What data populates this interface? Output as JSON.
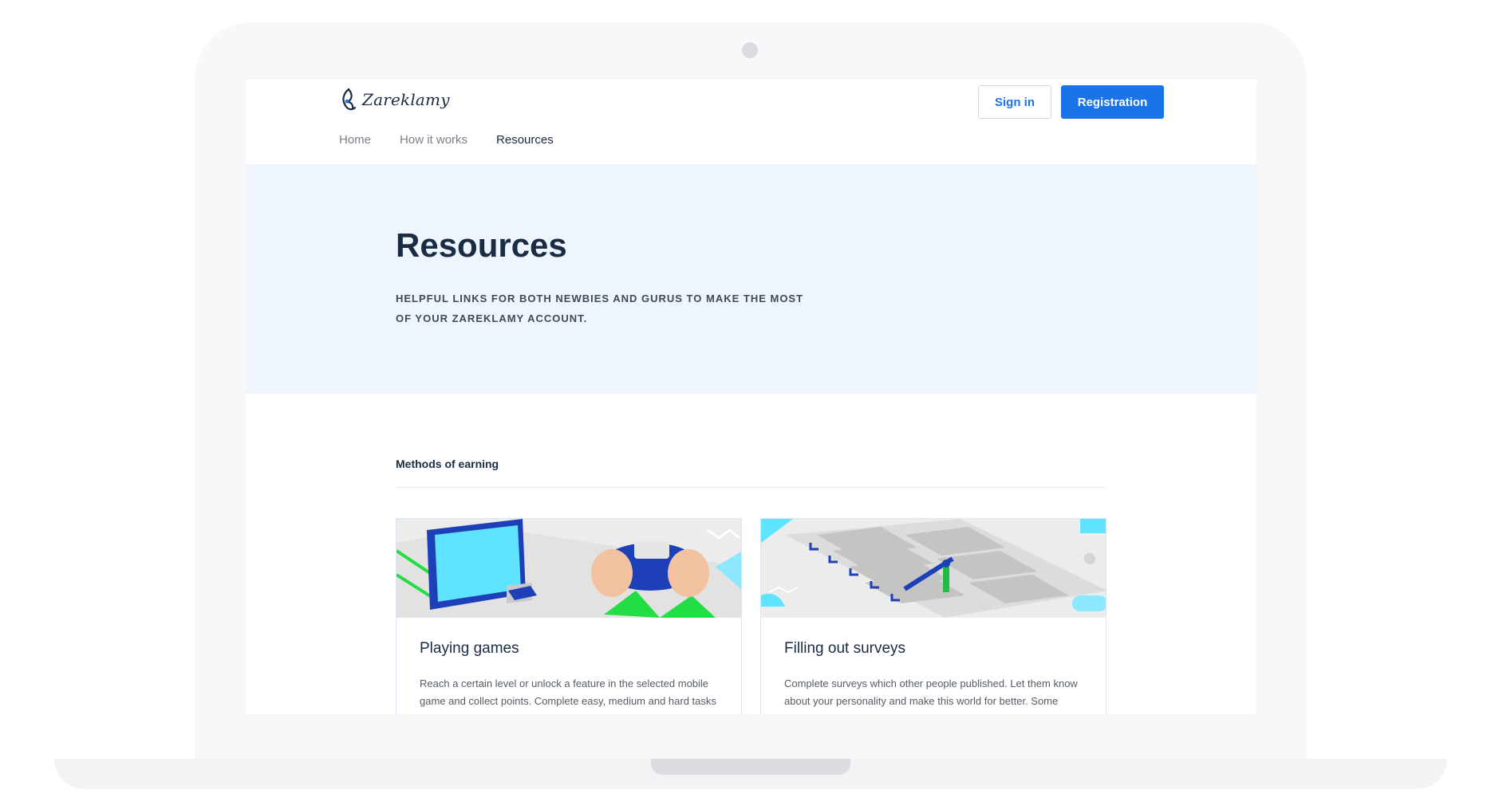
{
  "brand": {
    "name": "Zareklamy"
  },
  "header": {
    "signin_label": "Sign in",
    "register_label": "Registration"
  },
  "nav": {
    "items": [
      {
        "label": "Home"
      },
      {
        "label": "How it works"
      },
      {
        "label": "Resources"
      }
    ],
    "active": "Resources"
  },
  "hero": {
    "title": "Resources",
    "subtitle": "Helpful links for both newbies and gurus to make the most of your Zareklamy account."
  },
  "section": {
    "title": "Methods of earning",
    "cards": [
      {
        "title": "Playing games",
        "text": "Reach a certain level or unlock a feature in the selected mobile game and collect points. Complete easy, medium and hard tasks in games you like. The longer it takes, more to complete."
      },
      {
        "title": "Filling out surveys",
        "text": "Complete surveys which other people published. Let them know about your personality and make this world for better. Some people differ, but they will be grateful."
      }
    ]
  },
  "icons": {
    "logo": "zareklamy-logo-icon",
    "camera": "camera-icon"
  },
  "colors": {
    "accent": "#1a73e8",
    "heading": "#1a2b44",
    "hero_bg": "#eef5fd"
  }
}
